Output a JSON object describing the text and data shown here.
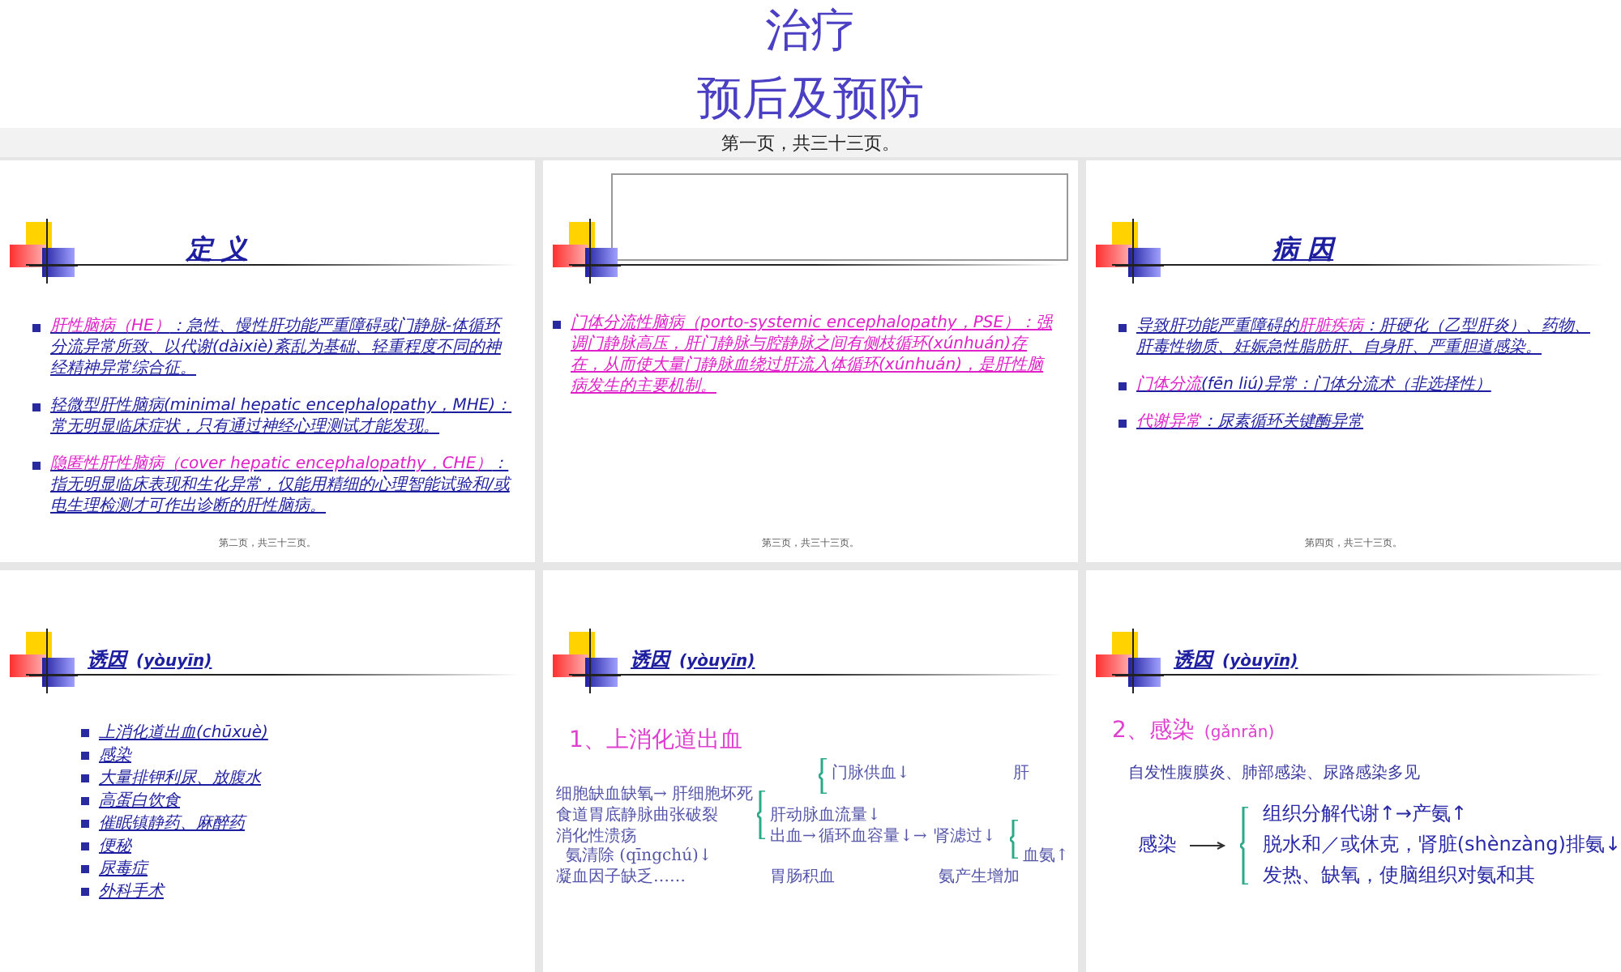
{
  "cover": {
    "lines": [
      "治疗",
      "预后及预防"
    ],
    "caption": "第一页，共三十三页。"
  },
  "slides": [
    {
      "kind": "bullets",
      "title": "定 义",
      "bullets": [
        "**肝性脑病（HE）**：急性、慢性肝功能严重障碍或门静脉-体循环分流异常所致、以代谢(dàixiè)紊乱为基础、轻重程度不同的神经精神异常综合征。",
        "轻微型肝性脑病(minimal hepatic encephalopathy，MHE)：常无明显临床症状，只有通过神经心理测试才能发现。",
        "**隐匿性肝性脑病（cover hepatic encephalopathy，CHE）**：指无明显临床表现和生化异常，仅能用精细的心理智能试验和/或电生理检测才可作出诊断的肝性脑病。"
      ],
      "footer": "第二页，共三十三页。"
    },
    {
      "kind": "boxed",
      "bullets": [
        "门体分流性脑病（porto-systemic encephalopathy，PSE）：强调门静脉高压，肝门静脉与腔静脉之间有侧枝循环(xúnhuán)存在，从而使大量门静脉血绕过肝流入体循环(xúnhuán)，是肝性脑病发生的主要机制。"
      ],
      "footer": "第三页，共三十三页。"
    },
    {
      "kind": "bullets",
      "title": "病 因",
      "bullets": [
        "导致肝功能严重障碍的**肝脏疾病**：肝硬化（乙型肝炎）、药物、肝毒性物质、妊娠急性脂肪肝、自身肝、严重胆道感染。",
        "**门体分流**(fēn liú)异常：门体分流术（非选择性）",
        "**代谢异常**：尿素循环关键酶异常"
      ],
      "footer": "第四页，共三十三页。"
    },
    {
      "kind": "list",
      "title": "诱因",
      "title_note": "(yòuyīn)",
      "items": [
        "上消化道出血(chūxuè)",
        "感染",
        "大量排钾利尿、放腹水",
        "高蛋白饮食",
        "催眠镇静药、麻醉药",
        "便秘",
        "尿毒症",
        "外科手术"
      ]
    },
    {
      "kind": "diagram",
      "title": "诱因",
      "title_note": "(yòuyīn)",
      "heading": "1、上消化道出血",
      "nodes": [
        "细胞缺血缺氧→ 肝细胞坏死",
        "食道胃底静脉曲张破裂",
        "消化性溃疡",
        "氨清除 (qīngchú)↓",
        "凝血因子缺乏……",
        "门脉供血↓",
        "肝",
        "肝动脉血流量↓",
        "出血→",
        "循环血容量↓→",
        "肾滤过↓",
        "血氨↑",
        "胃肠积血",
        "氨产生增加"
      ]
    },
    {
      "kind": "infection",
      "title": "诱因",
      "title_note": "(yòuyīn)",
      "heading": "2、感染",
      "heading_note": "(gǎnrǎn)",
      "summary": "自发性腹膜炎、肺部感染、尿路感染多见",
      "label": "感染",
      "effects": [
        "组织分解代谢↑→产氨↑",
        "脱水和／或休克，肾脏(shènzàng)排氨↓",
        "发热、缺氧，使脑组织对氨和其"
      ]
    }
  ]
}
